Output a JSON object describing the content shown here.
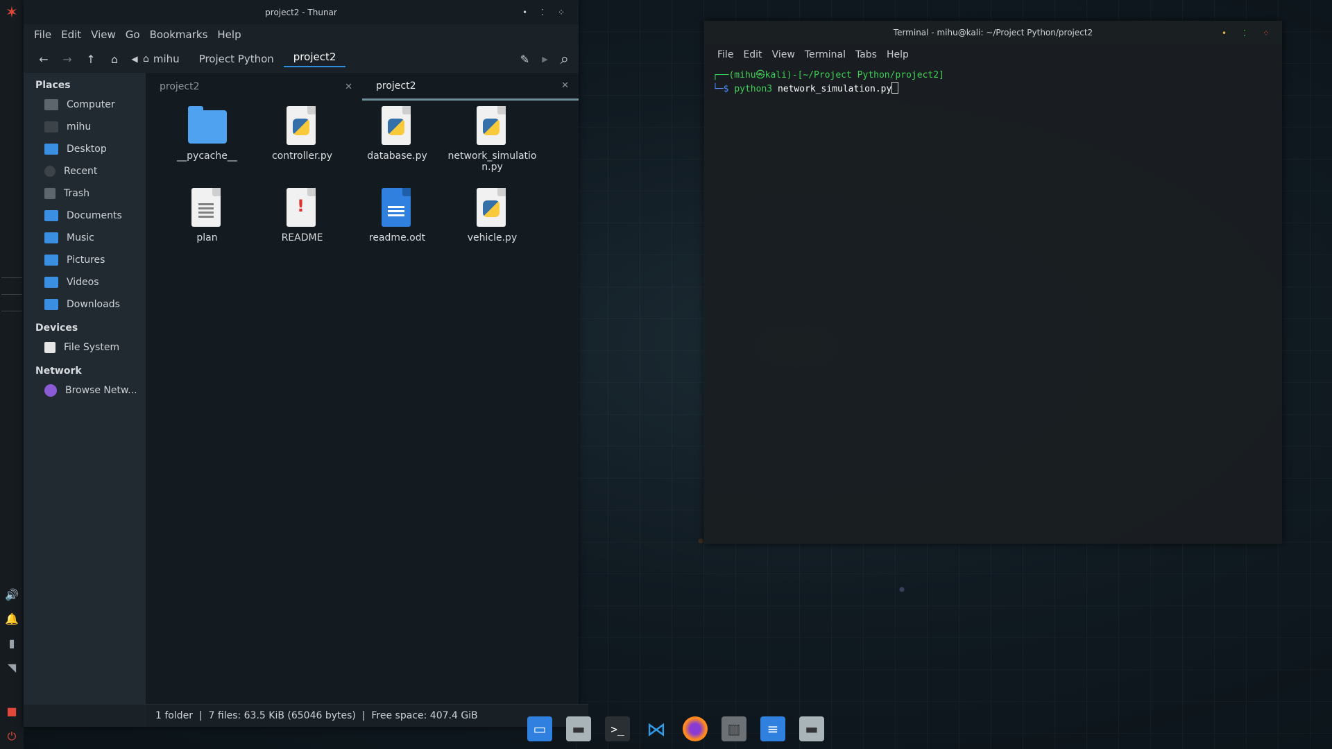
{
  "colors": {
    "accent": "#2e8ce0",
    "terminal_green": "#3fcf57",
    "terminal_blue": "#4e8df4"
  },
  "left_panel": {
    "icons": [
      "kali-logo-icon",
      "volume-icon",
      "bell-icon",
      "battery-icon",
      "wifi-icon",
      "lock-icon",
      "power-icon"
    ]
  },
  "thunar": {
    "title": "project2 - Thunar",
    "menu": [
      "File",
      "Edit",
      "View",
      "Go",
      "Bookmarks",
      "Help"
    ],
    "breadcrumbs": [
      "mihu",
      "Project Python",
      "project2"
    ],
    "sidebar": {
      "places_heading": "Places",
      "places": [
        "Computer",
        "mihu",
        "Desktop",
        "Recent",
        "Trash",
        "Documents",
        "Music",
        "Pictures",
        "Videos",
        "Downloads"
      ],
      "devices_heading": "Devices",
      "devices": [
        "File System"
      ],
      "network_heading": "Network",
      "network": [
        "Browse Netw..."
      ]
    },
    "tabs": [
      "project2",
      "project2"
    ],
    "files": [
      {
        "name": "__pycache__",
        "type": "folder"
      },
      {
        "name": "controller.py",
        "type": "python"
      },
      {
        "name": "database.py",
        "type": "python"
      },
      {
        "name": "network_simulatio\nn.py",
        "type": "python"
      },
      {
        "name": "plan",
        "type": "text"
      },
      {
        "name": "README",
        "type": "readme"
      },
      {
        "name": "readme.odt",
        "type": "odt"
      },
      {
        "name": "vehicle.py",
        "type": "python"
      }
    ],
    "status": "1 folder  |  7 files: 63.5 KiB (65046 bytes)  |  Free space: 407.4 GiB"
  },
  "terminal": {
    "title": "Terminal - mihu@kali: ~/Project Python/project2",
    "menu": [
      "File",
      "Edit",
      "View",
      "Terminal",
      "Tabs",
      "Help"
    ],
    "prompt_line_1": "┌──(mihu㉿kali)-[~/Project Python/project2]",
    "prompt_symbol": "└─$",
    "cmd_program": "python3",
    "cmd_arg": "network_simulation.py"
  },
  "dock": [
    "files-blue-icon",
    "file-manager-icon",
    "terminal-icon",
    "vscode-icon",
    "firefox-icon",
    "trash-icon",
    "writer-icon",
    "archive-icon"
  ]
}
